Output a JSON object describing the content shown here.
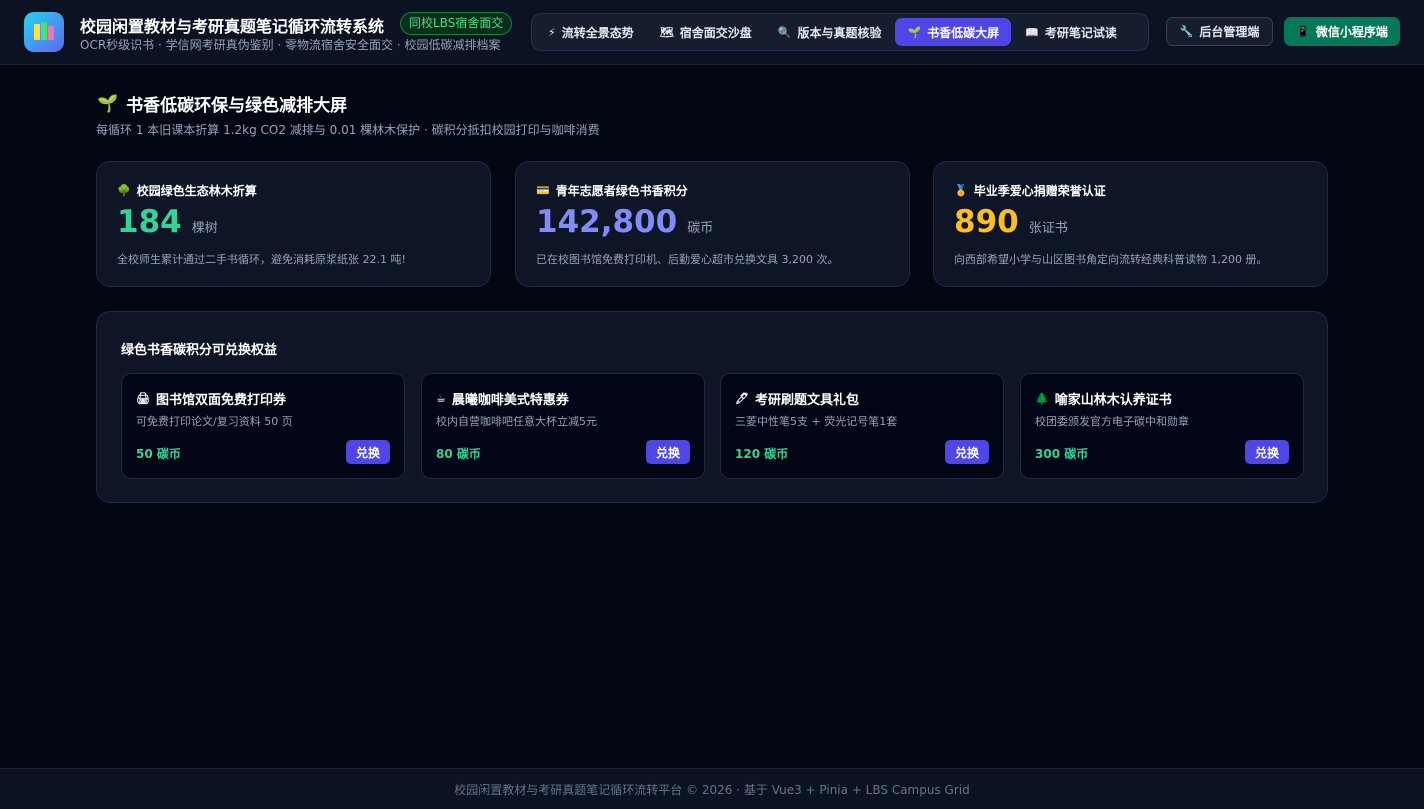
{
  "header": {
    "title": "校园闲置教材与考研真题笔记循环流转系统",
    "badge": "同校LBS宿舍面交",
    "subtitle": "OCR秒级识书 · 学信网考研真伪鉴别 · 零物流宿舍安全面交 · 校园低碳减排档案",
    "nav": [
      {
        "label": "流转全景态势",
        "icon": "⚡",
        "active": false
      },
      {
        "label": "宿舍面交沙盘",
        "icon": "🗺",
        "active": false
      },
      {
        "label": "版本与真题核验",
        "icon": "🔍",
        "active": false
      },
      {
        "label": "书香低碳大屏",
        "icon": "🌱",
        "active": true
      },
      {
        "label": "考研笔记试读",
        "icon": "📖",
        "active": false
      }
    ],
    "admin_button": {
      "label": "后台管理端",
      "icon": "🔧"
    },
    "wechat_button": {
      "label": "微信小程序端",
      "icon": "📱"
    }
  },
  "page": {
    "icon": "🌱",
    "title": "书香低碳环保与绿色减排大屏",
    "subtitle": "每循环 1 本旧课本折算 1.2kg CO2 减排与 0.01 棵林木保护 · 碳积分抵扣校园打印与咖啡消费"
  },
  "stats": [
    {
      "icon": "🌳",
      "title": "校园绿色生态林木折算",
      "value": "184",
      "unit": "棵树",
      "color": "#34d399",
      "desc": "全校师生累计通过二手书循环，避免消耗原浆纸张 22.1 吨!"
    },
    {
      "icon": "💳",
      "title": "青年志愿者绿色书香积分",
      "value": "142,800",
      "unit": "碳币",
      "color": "#818cf8",
      "desc": "已在校图书馆免费打印机、后勤爱心超市兑换文具 3,200 次。"
    },
    {
      "icon": "🏅",
      "title": "毕业季爱心捐赠荣誉认证",
      "value": "890",
      "unit": "张证书",
      "color": "#fbbf24",
      "desc": "向西部希望小学与山区图书角定向流转经典科普读物 1,200 册。"
    }
  ],
  "rewards": {
    "title": "绿色书香碳积分可兑换权益",
    "items": [
      {
        "icon": "🖨",
        "name": "图书馆双面免费打印券",
        "desc": "可免费打印论文/复习资料 50 页",
        "price": "50 碳币",
        "button": "兑换"
      },
      {
        "icon": "☕",
        "name": "晨曦咖啡美式特惠券",
        "desc": "校内自营咖啡吧任意大杯立减5元",
        "price": "80 碳币",
        "button": "兑换"
      },
      {
        "icon": "🖊",
        "name": "考研刷题文具礼包",
        "desc": "三菱中性笔5支 + 荧光记号笔1套",
        "price": "120 碳币",
        "button": "兑换"
      },
      {
        "icon": "🌲",
        "name": "喻家山林木认养证书",
        "desc": "校团委颁发官方电子碳中和勋章",
        "price": "300 碳币",
        "button": "兑换"
      }
    ]
  },
  "footer": {
    "text": "校园闲置教材与考研真题笔记循环流转平台 © 2026 · 基于 Vue3 + Pinia + LBS Campus Grid"
  }
}
